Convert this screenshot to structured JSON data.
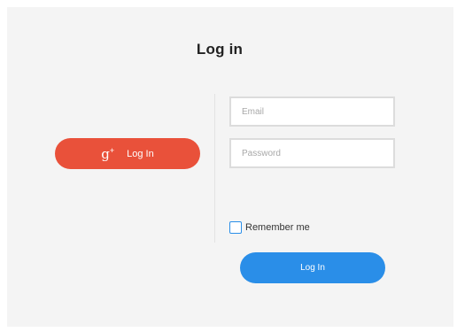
{
  "title": "Log in",
  "google_button": {
    "icon": "google-plus-icon",
    "icon_glyph": "g",
    "icon_plus": "+",
    "label": "Log In",
    "color": "#e9513a"
  },
  "form": {
    "email_placeholder": "Email",
    "password_placeholder": "Password",
    "remember_label": "Remember me",
    "remember_checked": false,
    "submit_label": "Log In",
    "submit_color": "#2a8ee8"
  }
}
